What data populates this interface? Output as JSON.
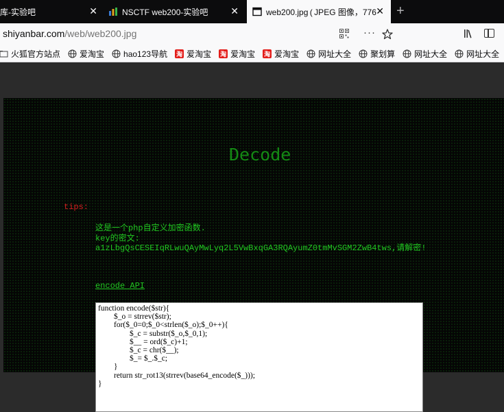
{
  "tabs": [
    {
      "label": "库-实验吧",
      "active": false
    },
    {
      "label": "NSCTF web200-实验吧",
      "active": false
    },
    {
      "label": "web200.jpg ( JPEG 图像，776",
      "active": true
    }
  ],
  "close_glyph": "✕",
  "new_tab_glyph": "+",
  "address_bar": {
    "host": "shiyanbar.com",
    "path": "/web/web200.jpg"
  },
  "more_glyph": "···",
  "bookmarks": [
    {
      "label": "火狐官方站点",
      "icon": "folder-icon"
    },
    {
      "label": "爱淘宝",
      "icon": "globe-icon"
    },
    {
      "label": "hao123导航",
      "icon": "globe-icon"
    },
    {
      "label": "爱淘宝",
      "icon": "taobao-icon"
    },
    {
      "label": "爱淘宝",
      "icon": "taobao-icon"
    },
    {
      "label": "爱淘宝",
      "icon": "taobao-icon"
    },
    {
      "label": "网址大全",
      "icon": "globe-icon"
    },
    {
      "label": "聚划算",
      "icon": "globe-icon"
    },
    {
      "label": "网址大全",
      "icon": "globe-icon"
    },
    {
      "label": "网址大全",
      "icon": "globe-icon"
    }
  ],
  "taobao_mark": "淘",
  "image": {
    "title": "Decode",
    "tips_label": "tips:",
    "line1": "这是一个php自定义加密函数.",
    "line2": "key的密文:",
    "line3": "a1zLbgQsCESEIqRLwuQAyMwLyq2L5VwBxqGA3RQAyumZ0tmMvSGM2ZwB4tws,请解密!",
    "api_link": "encode API",
    "code": "function encode($str){\n        $_o = strrev($str);\n        for($_0=0;$_0<strlen($_o);$_0++){\n                $_c = substr($_o,$_0,1);\n                $__ = ord($_c)+1;\n                $_c = chr($__);\n                $_= $_.$_c;\n        }\n        return str_rot13(strrev(base64_encode($_)));\n}"
  }
}
